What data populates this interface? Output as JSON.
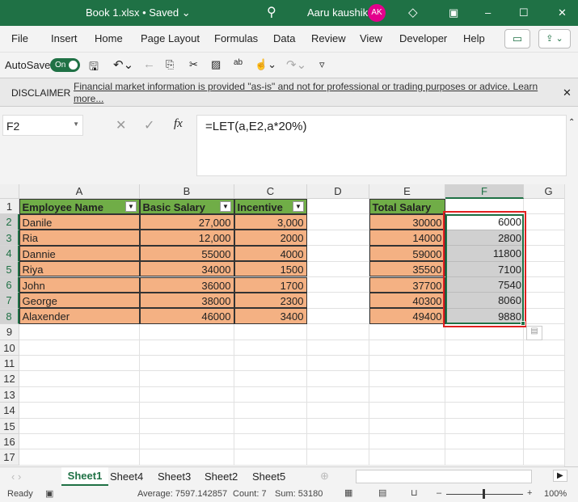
{
  "title": "Book 1.xlsx • Saved ⌄",
  "user": "Aaru kaushik",
  "initials": "AK",
  "ribbon_tabs": [
    "File",
    "Insert",
    "Home",
    "Page Layout",
    "Formulas",
    "Data",
    "Review",
    "View",
    "Developer",
    "Help"
  ],
  "autosave": {
    "label": "AutoSave",
    "state": "On"
  },
  "disclaimer": {
    "label": "DISCLAIMER",
    "text": "Financial market information is provided \"as-is\" and not for professional or trading purposes or advice. Learn more..."
  },
  "name_box": "F2",
  "formula": "=LET(a,E2,a*20%)",
  "columns": [
    "A",
    "B",
    "C",
    "D",
    "E",
    "F",
    "G"
  ],
  "rows": [
    "1",
    "2",
    "3",
    "4",
    "5",
    "6",
    "7",
    "8",
    "9",
    "10",
    "11",
    "12",
    "13",
    "14",
    "15",
    "16",
    "17"
  ],
  "headers": {
    "name": "Employee Name",
    "basic": "Basic Salary",
    "incentive": "Incentive",
    "total": "Total Salary"
  },
  "data": [
    {
      "name": "Danile",
      "basic": "27,000",
      "inc": "3,000",
      "total": "30000",
      "f": "6000"
    },
    {
      "name": "Ria",
      "basic": "12,000",
      "inc": "2000",
      "total": "14000",
      "f": "2800"
    },
    {
      "name": "Dannie",
      "basic": "55000",
      "inc": "4000",
      "total": "59000",
      "f": "11800"
    },
    {
      "name": "Riya",
      "basic": "34000",
      "inc": "1500",
      "total": "35500",
      "f": "7100"
    },
    {
      "name": "John",
      "basic": "36000",
      "inc": "1700",
      "total": "37700",
      "f": "7540"
    },
    {
      "name": "George",
      "basic": "38000",
      "inc": "2300",
      "total": "40300",
      "f": "8060"
    },
    {
      "name": "Alaxender",
      "basic": "46000",
      "inc": "3400",
      "total": "49400",
      "f": "9880"
    }
  ],
  "sheets": [
    "Sheet1",
    "Sheet4",
    "Sheet3",
    "Sheet2",
    "Sheet5"
  ],
  "active_sheet": "Sheet1",
  "status": {
    "ready": "Ready",
    "average": "Average: 7597.142857",
    "count": "Count: 7",
    "sum": "Sum: 53180",
    "zoom": "100%"
  },
  "colors": {
    "green": "#1f7145",
    "header_fill": "#70ad47",
    "data_fill": "#f4b183",
    "selection": "#d0d0d0",
    "highlight": "#e02020"
  }
}
